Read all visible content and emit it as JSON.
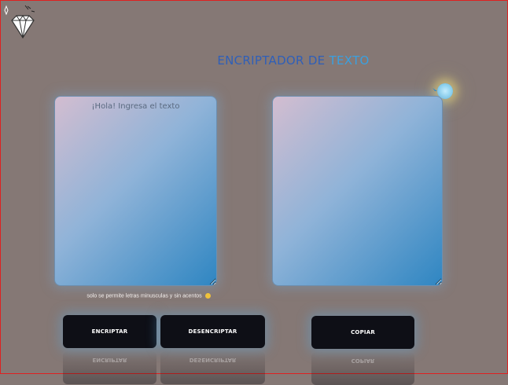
{
  "title": {
    "part1": "ENCRIPTADOR DE ",
    "part2": "TEXTO"
  },
  "input": {
    "placeholder": "¡Hola! Ingresa el texto",
    "value": ""
  },
  "output": {
    "value": ""
  },
  "hint": {
    "text": "solo se permite letras minusculas y sin acentos"
  },
  "buttons": {
    "encrypt_label": "ENCRIPTAR",
    "decrypt_label": "DESENCRIPTAR",
    "copy_label": "COPIAR"
  },
  "icons": {
    "logo": "diamond-logo-icon",
    "orb": "glowing-orb-icon",
    "hint_emoji": "smiley-emoji-icon"
  },
  "colors": {
    "background": "#857875",
    "title_primary": "#2f5fb8",
    "title_accent": "#3aa0e0",
    "button": "#0e0f16"
  }
}
